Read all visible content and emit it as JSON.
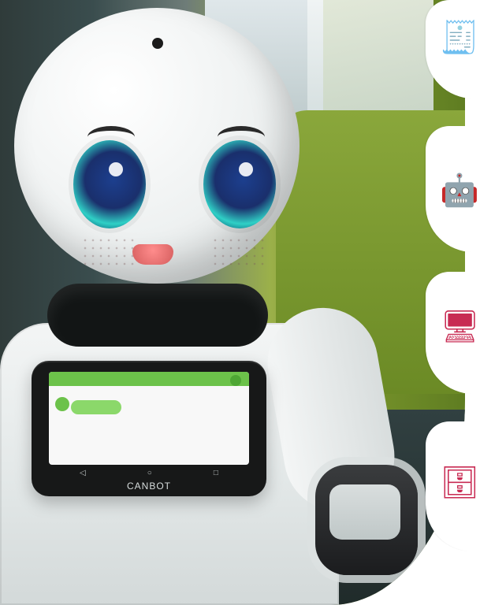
{
  "tablet": {
    "brand": "CANBOT",
    "nav": [
      "◁",
      "○",
      "□"
    ]
  },
  "right_rail": {
    "accent": "#c82b53",
    "icons": [
      {
        "name": "document-checklist-icon",
        "glyph": "🧾"
      },
      {
        "name": "robot-head-icon",
        "glyph": "🤖"
      },
      {
        "name": "desktop-computer-icon",
        "glyph": "🖥"
      },
      {
        "name": "desk-workstation-icon",
        "glyph": "🗄"
      }
    ]
  }
}
